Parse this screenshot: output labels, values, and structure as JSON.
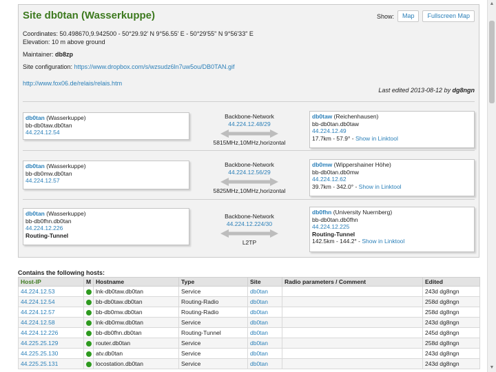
{
  "site": {
    "title": "Site db0tan (Wasserkuppe)",
    "show_label": "Show:",
    "map_button": "Map",
    "fullscreen_button": "Fullscreen Map",
    "coordinates": "Coordinates: 50.498670,9.942500  -  50°29.92' N 9°56.55' E  -  50°29'55\" N 9°56'33\" E",
    "elevation": "Elevation: 10 m above ground",
    "maintainer_label": "Maintainer:",
    "maintainer": "db8zp",
    "config_label": "Site configuration:",
    "config_link": "https://www.dropbox.com/s/wzsudz6ln7uw5ou/DB0TAN.gif",
    "extra_link": "http://www.fox06.de/relais/relais.htm",
    "edited_prefix": "Last edited 2013-08-12 by",
    "edited_by": "dg8ngn"
  },
  "links": [
    {
      "left": {
        "name": "db0tan",
        "site": " (Wasserkuppe)",
        "host": "bb-db0taw.db0tan",
        "ip": "44.224.12.54",
        "tunnel": ""
      },
      "mid": {
        "network": "Backbone-Network",
        "subnet": "44.224.12.48/29",
        "params": "5815MHz,10MHz,horizontal"
      },
      "right": {
        "name": "db0taw",
        "site": " (Reichenhausen)",
        "host": "bb-db0tan.db0taw",
        "ip": "44.224.12.49",
        "tunnel": "",
        "dist": "17.7km - 57.9° - ",
        "linktool": "Show in Linktool"
      }
    },
    {
      "left": {
        "name": "db0tan",
        "site": " (Wasserkuppe)",
        "host": "bb-db0mw.db0tan",
        "ip": "44.224.12.57",
        "tunnel": ""
      },
      "mid": {
        "network": "Backbone-Network",
        "subnet": "44.224.12.56/29",
        "params": "5825MHz,10MHz,horizontal"
      },
      "right": {
        "name": "db0mw",
        "site": " (Wippershainer Höhe)",
        "host": "bb-db0tan.db0mw",
        "ip": "44.224.12.62",
        "tunnel": "",
        "dist": "39.7km - 342.0° - ",
        "linktool": "Show in Linktool"
      }
    },
    {
      "left": {
        "name": "db0tan",
        "site": " (Wasserkuppe)",
        "host": "bb-db0fhn.db0tan",
        "ip": "44.224.12.226",
        "tunnel": "Routing-Tunnel"
      },
      "mid": {
        "network": "Backbone-Network",
        "subnet": "44.224.12.224/30",
        "params": "L2TP"
      },
      "right": {
        "name": "db0fhn",
        "site": " (University Nuernberg)",
        "host": "bb-db0tan.db0fhn",
        "ip": "44.224.12.225",
        "tunnel": "Routing-Tunnel",
        "dist": "142.5km - 144.2° - ",
        "linktool": "Show in Linktool"
      }
    }
  ],
  "hosts": {
    "title": "Contains the following hosts:",
    "columns": [
      "Host-IP",
      "M",
      "Hostname",
      "Type",
      "Site",
      "Radio parameters / Comment",
      "Edited"
    ],
    "rows": [
      {
        "ip": "44.224.12.53",
        "hostname": "lnk-db0taw.db0tan",
        "type": "Service",
        "site": "db0tan",
        "comment": "",
        "edited": "243d dg8ngn"
      },
      {
        "ip": "44.224.12.54",
        "hostname": "bb-db0taw.db0tan",
        "type": "Routing-Radio",
        "site": "db0tan",
        "comment": "",
        "edited": "258d dg8ngn"
      },
      {
        "ip": "44.224.12.57",
        "hostname": "bb-db0mw.db0tan",
        "type": "Routing-Radio",
        "site": "db0tan",
        "comment": "",
        "edited": "258d dg8ngn"
      },
      {
        "ip": "44.224.12.58",
        "hostname": "lnk-db0mw.db0tan",
        "type": "Service",
        "site": "db0tan",
        "comment": "",
        "edited": "243d dg8ngn"
      },
      {
        "ip": "44.224.12.226",
        "hostname": "bb-db0fhn.db0tan",
        "type": "Routing-Tunnel",
        "site": "db0tan",
        "comment": "",
        "edited": "245d dg8ngn"
      },
      {
        "ip": "44.225.25.129",
        "hostname": "router.db0tan",
        "type": "Service",
        "site": "db0tan",
        "comment": "",
        "edited": "258d dg8ngn"
      },
      {
        "ip": "44.225.25.130",
        "hostname": "atv.db0tan",
        "type": "Service",
        "site": "db0tan",
        "comment": "",
        "edited": "243d dg8ngn"
      },
      {
        "ip": "44.225.25.131",
        "hostname": "locostation.db0tan",
        "type": "Service",
        "site": "db0tan",
        "comment": "",
        "edited": "243d dg8ngn"
      }
    ]
  },
  "colors": {
    "title_green": "#3d7a1f",
    "link_blue": "#2a7fb8",
    "status_green": "#2e9a1f"
  }
}
